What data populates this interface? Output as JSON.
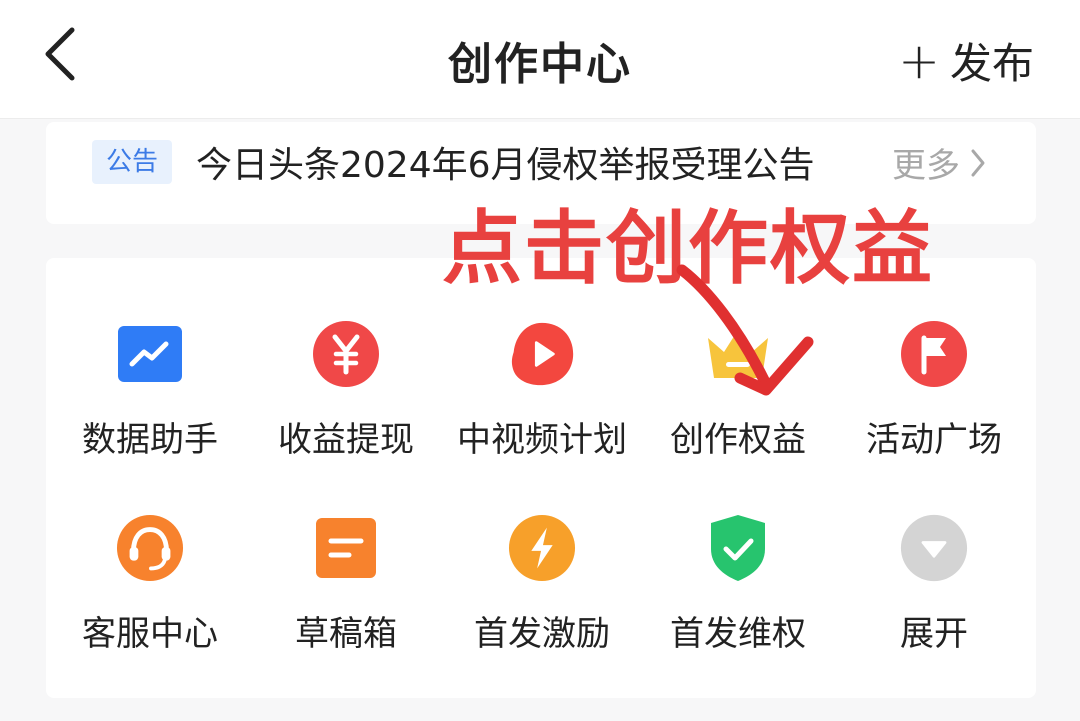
{
  "header": {
    "title": "创作中心",
    "publish_label": "发布"
  },
  "notice": {
    "tag": "公告",
    "text": "今日头条2024年6月侵权举报受理公告",
    "more_label": "更多"
  },
  "annotation": {
    "text": "点击创作权益",
    "color": "#e8413f"
  },
  "tools": [
    {
      "label": "数据助手",
      "icon": "data-chart-icon",
      "color": "#2f7cf6"
    },
    {
      "label": "收益提现",
      "icon": "yuan-icon",
      "color": "#f04848"
    },
    {
      "label": "中视频计划",
      "icon": "play-icon",
      "color": "#f3473f"
    },
    {
      "label": "创作权益",
      "icon": "crown-icon",
      "color": "#f7c43c"
    },
    {
      "label": "活动广场",
      "icon": "flag-icon",
      "color": "#f04848"
    },
    {
      "label": "客服中心",
      "icon": "headset-icon",
      "color": "#f7822d"
    },
    {
      "label": "草稿箱",
      "icon": "draft-icon",
      "color": "#f7822d"
    },
    {
      "label": "首发激励",
      "icon": "lightning-icon",
      "color": "#f7a02a"
    },
    {
      "label": "首发维权",
      "icon": "shield-check-icon",
      "color": "#27c46e"
    },
    {
      "label": "展开",
      "icon": "expand-down-icon",
      "color": "#d4d4d4"
    }
  ]
}
